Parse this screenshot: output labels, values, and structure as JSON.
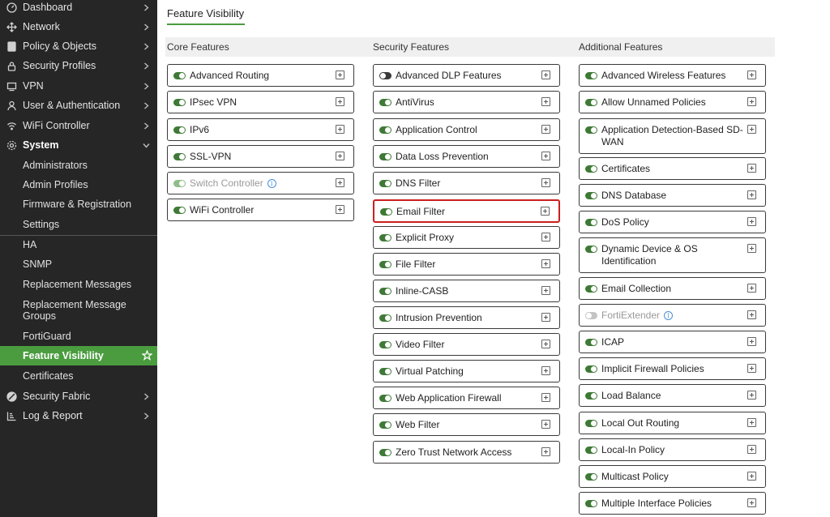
{
  "sidebar": {
    "items": [
      {
        "label": "Dashboard",
        "icon": "dashboard-icon"
      },
      {
        "label": "Network",
        "icon": "network-icon"
      },
      {
        "label": "Policy & Objects",
        "icon": "policy-icon"
      },
      {
        "label": "Security Profiles",
        "icon": "lock-icon"
      },
      {
        "label": "VPN",
        "icon": "monitor-icon"
      },
      {
        "label": "User & Authentication",
        "icon": "user-icon"
      },
      {
        "label": "WiFi Controller",
        "icon": "wifi-icon"
      },
      {
        "label": "System",
        "icon": "gear-icon"
      }
    ],
    "system_children": [
      "Administrators",
      "Admin Profiles",
      "Firmware & Registration",
      "Settings",
      "HA",
      "SNMP",
      "Replacement Messages",
      "Replacement Message Groups",
      "FortiGuard",
      "Feature Visibility",
      "Certificates"
    ],
    "bottom_items": [
      {
        "label": "Security Fabric",
        "icon": "fabric-icon"
      },
      {
        "label": "Log & Report",
        "icon": "report-icon"
      }
    ]
  },
  "page": {
    "title": "Feature Visibility",
    "columns": {
      "core": "Core Features",
      "security": "Security Features",
      "additional": "Additional Features"
    }
  },
  "core_features": [
    {
      "label": "Advanced Routing",
      "state": "on"
    },
    {
      "label": "IPsec VPN",
      "state": "on"
    },
    {
      "label": "IPv6",
      "state": "on"
    },
    {
      "label": "SSL-VPN",
      "state": "on"
    },
    {
      "label": "Switch Controller",
      "state": "disabled-on",
      "info": true
    },
    {
      "label": "WiFi Controller",
      "state": "on"
    }
  ],
  "security_features": [
    {
      "label": "Advanced DLP Features",
      "state": "off"
    },
    {
      "label": "AntiVirus",
      "state": "on"
    },
    {
      "label": "Application Control",
      "state": "on"
    },
    {
      "label": "Data Loss Prevention",
      "state": "on"
    },
    {
      "label": "DNS Filter",
      "state": "on"
    },
    {
      "label": "Email Filter",
      "state": "on",
      "highlight": true
    },
    {
      "label": "Explicit Proxy",
      "state": "on"
    },
    {
      "label": "File Filter",
      "state": "on"
    },
    {
      "label": "Inline-CASB",
      "state": "on"
    },
    {
      "label": "Intrusion Prevention",
      "state": "on"
    },
    {
      "label": "Video Filter",
      "state": "on"
    },
    {
      "label": "Virtual Patching",
      "state": "on"
    },
    {
      "label": "Web Application Firewall",
      "state": "on"
    },
    {
      "label": "Web Filter",
      "state": "on"
    },
    {
      "label": "Zero Trust Network Access",
      "state": "on"
    }
  ],
  "additional_features": [
    {
      "label": "Advanced Wireless Features",
      "state": "on"
    },
    {
      "label": "Allow Unnamed Policies",
      "state": "on"
    },
    {
      "label": "Application Detection-Based SD-",
      "label2": "WAN",
      "state": "on"
    },
    {
      "label": "Certificates",
      "state": "on"
    },
    {
      "label": "DNS Database",
      "state": "on"
    },
    {
      "label": "DoS Policy",
      "state": "on"
    },
    {
      "label": "Dynamic Device & OS",
      "label2": "Identification",
      "state": "on"
    },
    {
      "label": "Email Collection",
      "state": "on"
    },
    {
      "label": "FortiExtender",
      "state": "disabled-off",
      "info": true
    },
    {
      "label": "ICAP",
      "state": "on"
    },
    {
      "label": "Implicit Firewall Policies",
      "state": "on"
    },
    {
      "label": "Load Balance",
      "state": "on"
    },
    {
      "label": "Local Out Routing",
      "state": "on"
    },
    {
      "label": "Local-In Policy",
      "state": "on"
    },
    {
      "label": "Multicast Policy",
      "state": "on"
    },
    {
      "label": "Multiple Interface Policies",
      "state": "on"
    }
  ],
  "colors": {
    "sidebar_bg": "#262626",
    "accent_green": "#4a9c3f",
    "highlight_red": "#cc1f1f"
  }
}
